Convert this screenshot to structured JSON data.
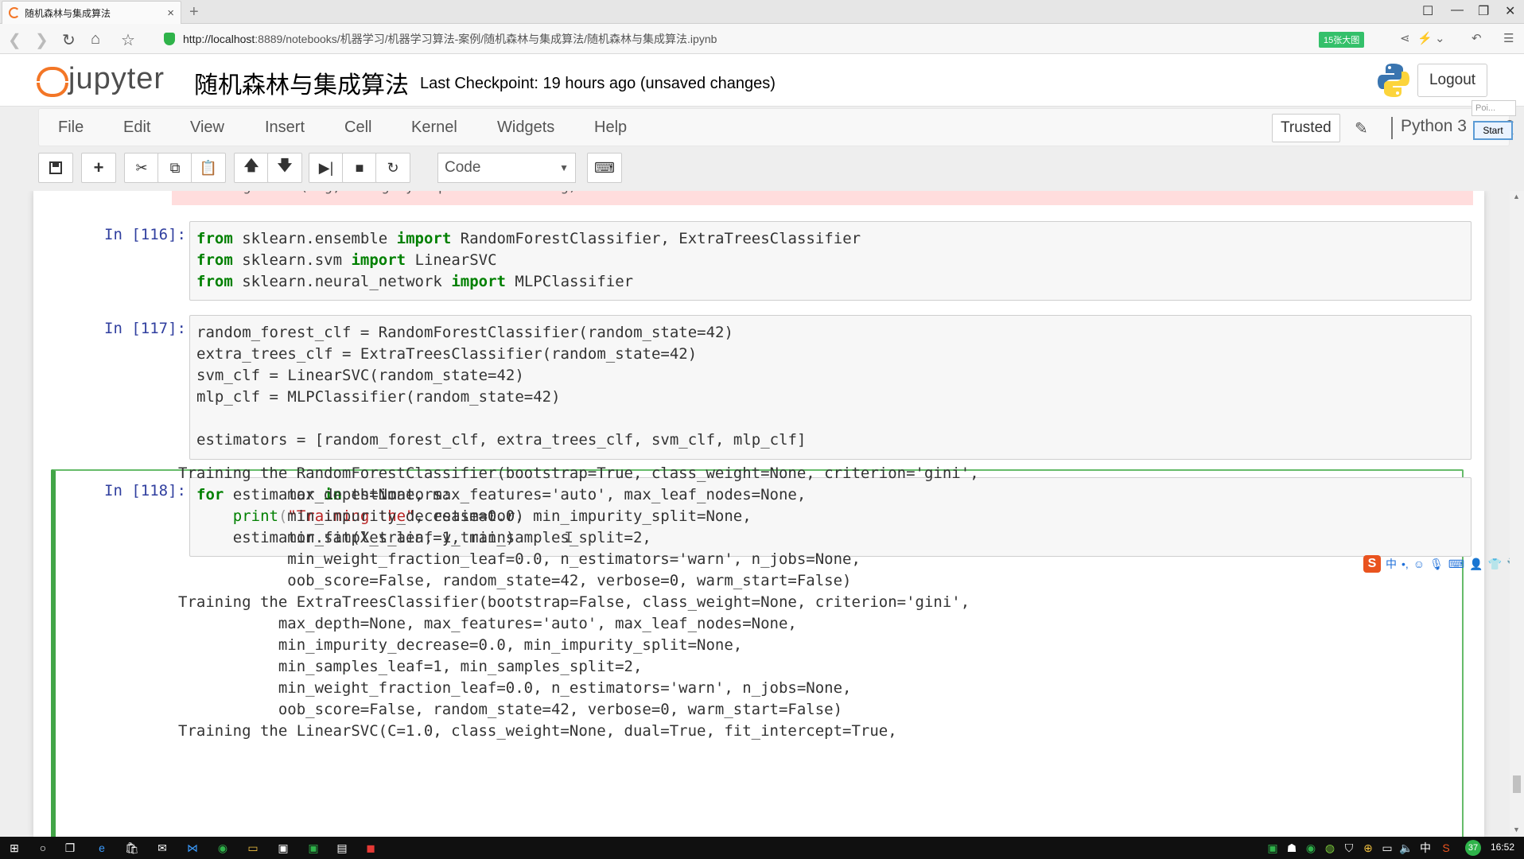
{
  "browser": {
    "tab_title": "随机森林与集成算法",
    "tab_close": "×",
    "new_tab": "+",
    "url_host": "http://localhost",
    "url_rest": ":8889/notebooks/机器学习/机器学习算法-案例/随机森林与集成算法/随机森林与集成算法.ipynb",
    "promo_badge": "15张大图"
  },
  "header": {
    "logo_text": "jupyter",
    "notebook_name": "随机森林与集成算法",
    "checkpoint": "Last Checkpoint: 19 hours ago (unsaved changes)",
    "logout_label": "Logout"
  },
  "menubar": {
    "items": [
      "File",
      "Edit",
      "View",
      "Insert",
      "Cell",
      "Kernel",
      "Widgets",
      "Help"
    ],
    "trusted_label": "Trusted",
    "kernel_name": "Python 3",
    "popup_tab": "Poi...",
    "start_label": "Start"
  },
  "toolbar": {
    "cell_type": "Code",
    "cell_type_arrow": "▼"
  },
  "cells": {
    "error_tail": "warnings.warn(msg, category=DeprecationWarning)",
    "cell116": {
      "prompt": "In [116]:",
      "lines": [
        [
          "from",
          " sklearn.ensemble ",
          "import",
          " RandomForestClassifier, ExtraTreesClassifier"
        ],
        [
          "from",
          " sklearn.svm ",
          "import",
          " LinearSVC"
        ],
        [
          "from",
          " sklearn.neural_network ",
          "import",
          " MLPClassifier"
        ]
      ]
    },
    "cell117": {
      "prompt": "In [117]:",
      "lines": [
        "random_forest_clf = RandomForestClassifier(random_state=42)",
        "extra_trees_clf = ExtraTreesClassifier(random_state=42)",
        "svm_clf = LinearSVC(random_state=42)",
        "mlp_clf = MLPClassifier(random_state=42)",
        "",
        "estimators = [random_forest_clf, extra_trees_clf, svm_clf, mlp_clf]"
      ]
    },
    "cell118": {
      "prompt": "In [118]:",
      "line1_kw1": "for",
      "line1_mid": " estimator ",
      "line1_kw2": "in",
      "line1_end": " estimators:",
      "line2_fn": "    print",
      "line2_str": "\"Training the\"",
      "line2_end": ", estimator)",
      "line3": "    estimator.fit(X_train, y_train)",
      "output": [
        "Training the RandomForestClassifier(bootstrap=True, class_weight=None, criterion='gini',",
        "            max_depth=None, max_features='auto', max_leaf_nodes=None,",
        "            min_impurity_decrease=0.0, min_impurity_split=None,",
        "            min_samples_leaf=1, min_samples_split=2,",
        "            min_weight_fraction_leaf=0.0, n_estimators='warn', n_jobs=None,",
        "            oob_score=False, random_state=42, verbose=0, warm_start=False)",
        "Training the ExtraTreesClassifier(bootstrap=False, class_weight=None, criterion='gini',",
        "           max_depth=None, max_features='auto', max_leaf_nodes=None,",
        "           min_impurity_decrease=0.0, min_impurity_split=None,",
        "           min_samples_leaf=1, min_samples_split=2,",
        "           min_weight_fraction_leaf=0.0, n_estimators='warn', n_jobs=None,",
        "           oob_score=False, random_state=42, verbose=0, warm_start=False)",
        "Training the LinearSVC(C=1.0, class_weight=None, dual=True, fit_intercept=True,"
      ]
    }
  },
  "ime": {
    "logo": "S",
    "lang": "中"
  },
  "taskbar": {
    "tray_lang": "中",
    "badge": "37",
    "time": "16:52"
  },
  "colors": {
    "jupyter_orange": "#f37626",
    "selected_cell_green": "#42a547",
    "keyword_green": "#008000",
    "string_red": "#ba2121",
    "prompt_blue": "#303f9f"
  }
}
